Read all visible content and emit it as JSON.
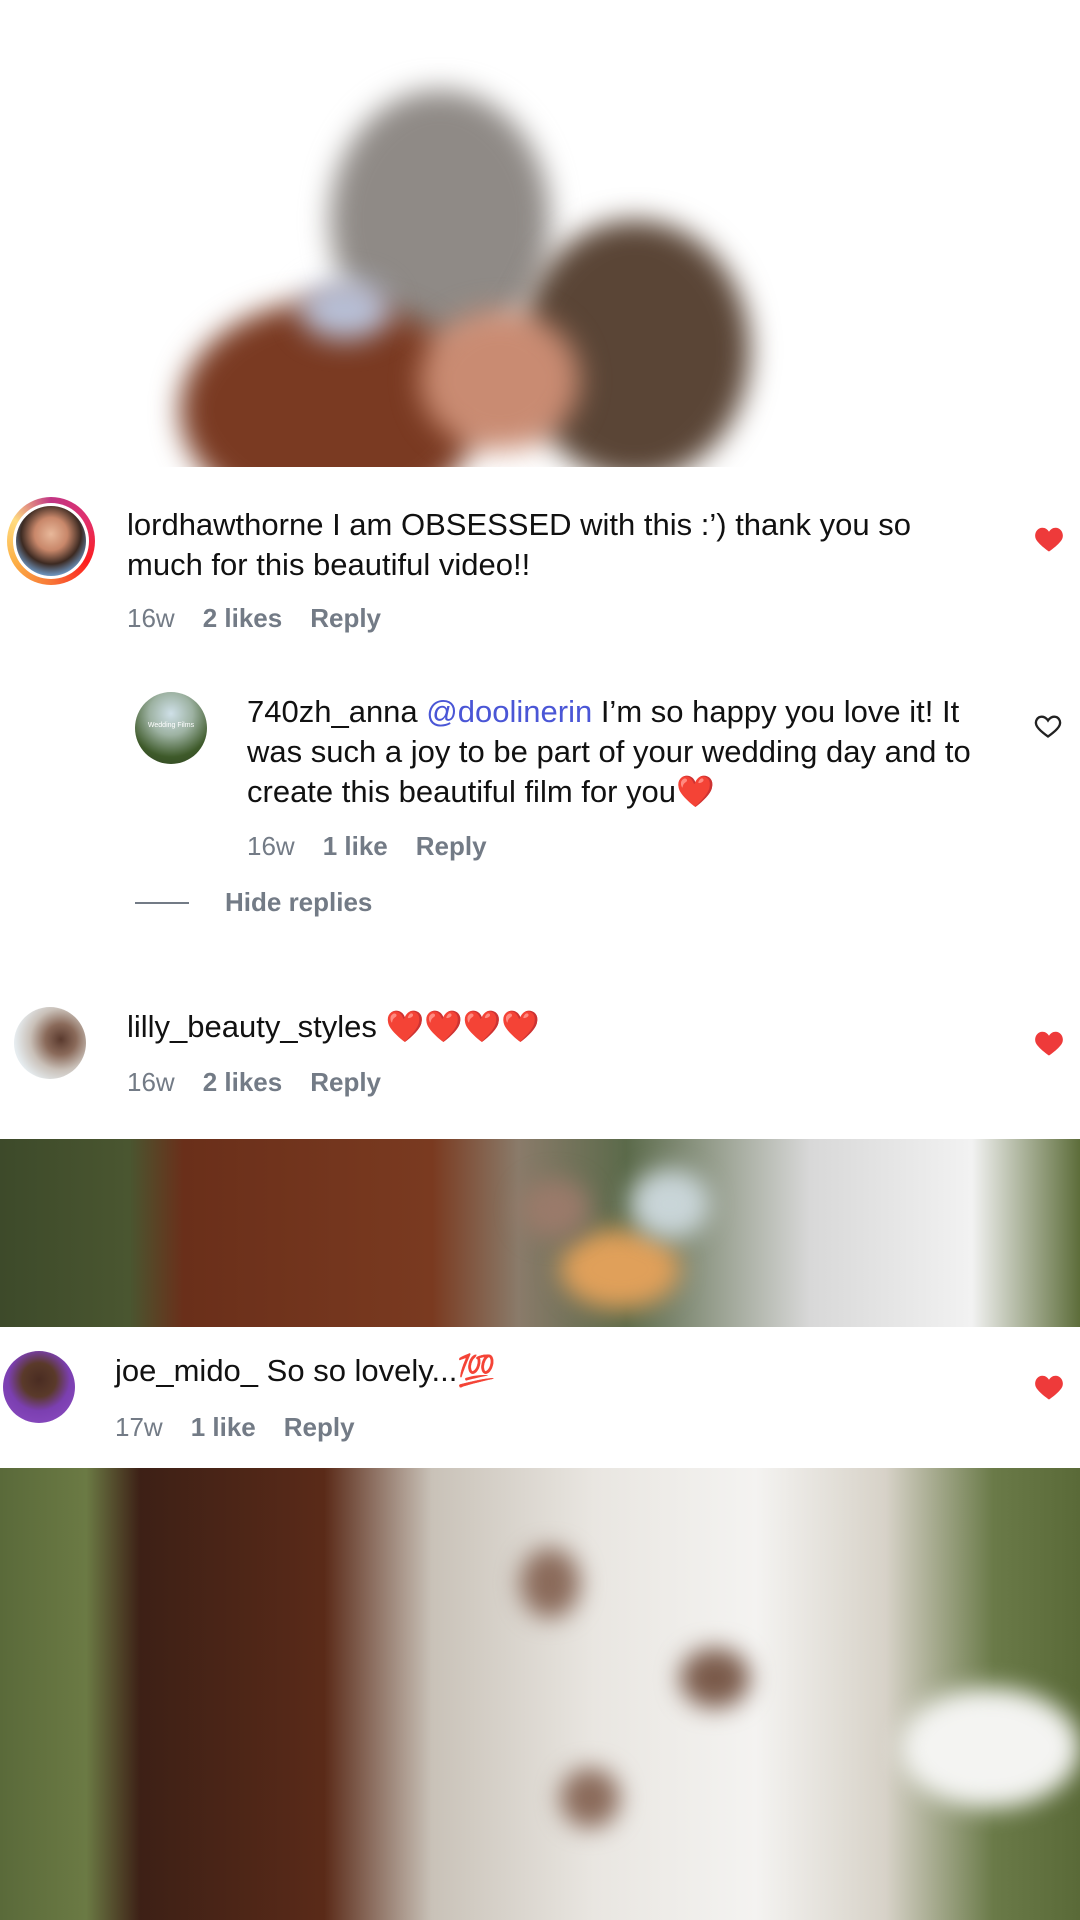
{
  "colors": {
    "liked_heart": "#ee3a3a",
    "meta_text": "#737b86",
    "mention": "#4a56d6"
  },
  "comments": [
    {
      "username": "lordhawthorne",
      "text": " I am OBSESSED with this :’) thank you so much for this beautiful video!!",
      "time": "16w",
      "likes": "2 likes",
      "reply_label": "Reply",
      "liked": true,
      "avatar_icon": "profile-photo-avatar"
    },
    {
      "username": "740zh_anna",
      "mention": "@doolinerin",
      "text": " I’m so happy you love it! It was such a joy to be part of your wedding day and to create this beautiful film for you❤️",
      "time": "16w",
      "likes": "1 like",
      "reply_label": "Reply",
      "liked": false,
      "avatar_logo_text": "Wedding Films"
    },
    {
      "username": "lilly_beauty_styles",
      "text": " ❤️❤️❤️❤️",
      "time": "16w",
      "likes": "2 likes",
      "reply_label": "Reply",
      "liked": true
    },
    {
      "username": "joe_mido_",
      "text": " So so lovely...💯",
      "time": "17w",
      "likes": "1 like",
      "reply_label": "Reply",
      "liked": true
    }
  ],
  "hide_replies_label": "Hide replies"
}
